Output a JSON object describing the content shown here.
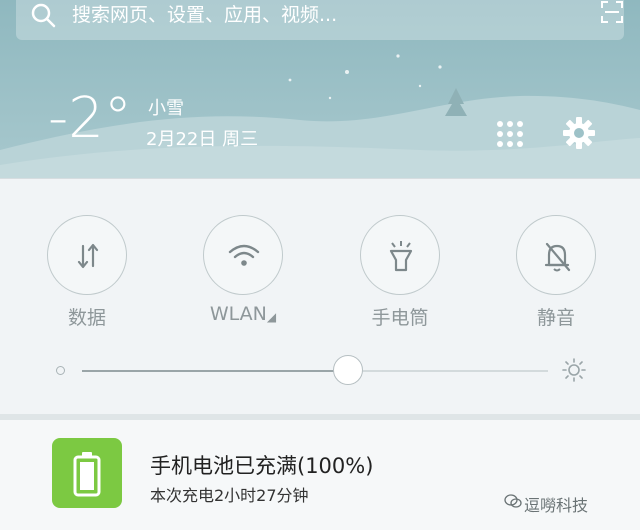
{
  "search": {
    "placeholder": "搜索网页、设置、应用、视频..."
  },
  "weather": {
    "temperature": "-2°",
    "condition": "小雪",
    "date": "2月22日 周三"
  },
  "toggles": [
    {
      "label": "数据",
      "icon": "data-arrows-icon"
    },
    {
      "label": "WLAN",
      "icon": "wifi-icon"
    },
    {
      "label": "手电筒",
      "icon": "flashlight-icon"
    },
    {
      "label": "静音",
      "icon": "bell-muted-icon"
    }
  ],
  "brightness": {
    "level": 0.57
  },
  "notification": {
    "title": "手机电池已充满(100%)",
    "subtitle": "本次充电2小时27分钟",
    "icon": "battery-icon"
  },
  "watermark": {
    "text": "逗嘮科技"
  },
  "colors": {
    "weather_bg": "#9ec2c8",
    "battery_green": "#7cc942",
    "panel_bg": "#f1f4f6"
  }
}
